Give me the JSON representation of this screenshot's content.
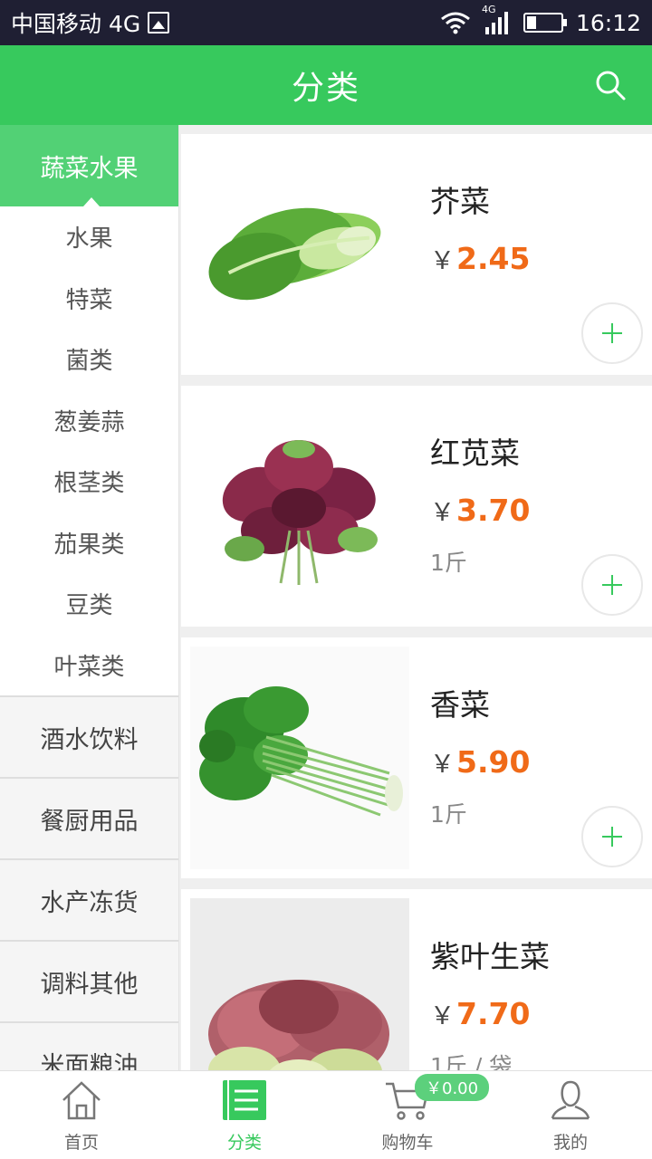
{
  "status_bar": {
    "carrier": "中国移动 4G",
    "network": "4G",
    "time": "16:12"
  },
  "header": {
    "title": "分类"
  },
  "sidebar": {
    "active": "蔬菜水果",
    "subcategories": [
      "水果",
      "特菜",
      "菌类",
      "葱姜蒜",
      "根茎类",
      "茄果类",
      "豆类",
      "叶菜类"
    ],
    "categories": [
      "酒水饮料",
      "餐厨用品",
      "水产冻货",
      "调料其他",
      "米面粮油"
    ]
  },
  "products": [
    {
      "name": "芥菜",
      "currency": "￥",
      "price": "2.45",
      "unit": ""
    },
    {
      "name": "红苋菜",
      "currency": "￥",
      "price": "3.70",
      "unit": "1斤"
    },
    {
      "name": "香菜",
      "currency": "￥",
      "price": "5.90",
      "unit": "1斤"
    },
    {
      "name": "紫叶生菜",
      "currency": "￥",
      "price": "7.70",
      "unit": "1斤 / 袋"
    }
  ],
  "bottom_nav": {
    "items": [
      {
        "label": "首页",
        "icon": "home-icon"
      },
      {
        "label": "分类",
        "icon": "category-icon"
      },
      {
        "label": "购物车",
        "icon": "cart-icon"
      },
      {
        "label": "我的",
        "icon": "user-icon"
      }
    ],
    "cart_badge": "￥0.00"
  },
  "colors": {
    "brand": "#37c95d",
    "price": "#f06a18",
    "status_bar": "#1f1f33"
  }
}
